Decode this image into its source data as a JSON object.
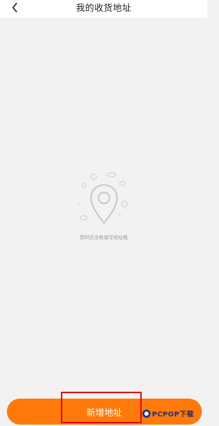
{
  "header": {
    "title": "我的收货地址",
    "back_icon": "chevron-left-icon"
  },
  "empty_state": {
    "icon": "location-pin-icon",
    "message": "暂时还没有填写地址哦"
  },
  "bottom": {
    "add_address_label": "新增地址"
  },
  "watermark": {
    "text": "PCPOP下载"
  },
  "colors": {
    "accent": "#ff7a0a",
    "highlight": "#e60000",
    "background": "#f2f2f2"
  }
}
